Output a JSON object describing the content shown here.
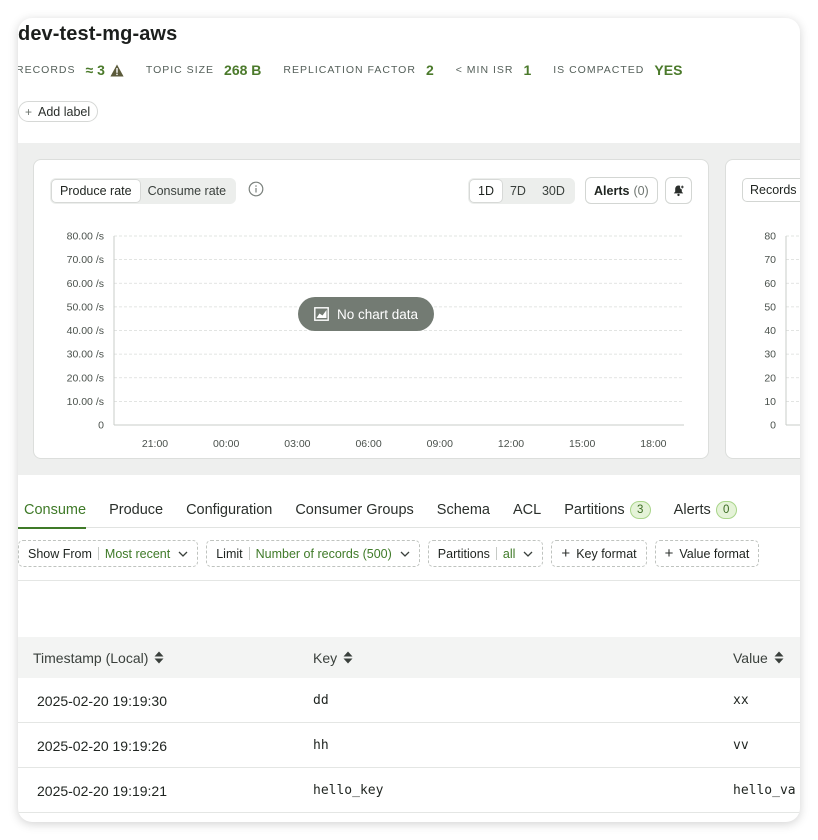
{
  "topic": {
    "title": "dev-test-mg-aws",
    "stats": {
      "records_label": "RECORDS",
      "records_value": "≈ 3",
      "topic_size_label": "TOPIC SIZE",
      "topic_size_value": "268 B",
      "replication_label": "REPLICATION FACTOR",
      "replication_value": "2",
      "min_isr_label": "< MIN ISR",
      "min_isr_value": "1",
      "compacted_label": "IS COMPACTED",
      "compacted_value": "YES"
    },
    "add_label": "Add label"
  },
  "chart_panel": {
    "rate_tabs": [
      "Produce rate",
      "Consume rate"
    ],
    "range_tabs": [
      "1D",
      "7D",
      "30D"
    ],
    "alerts_label": "Alerts",
    "alerts_count": "(0)",
    "no_data": "No chart data",
    "side_button": "Records"
  },
  "chart_data": [
    {
      "type": "line",
      "title": "",
      "xlabel": "",
      "ylabel": "",
      "x_ticks": [
        "21:00",
        "00:00",
        "03:00",
        "06:00",
        "09:00",
        "12:00",
        "15:00",
        "18:00"
      ],
      "y_ticks": [
        "0",
        "10.00 /s",
        "20.00 /s",
        "30.00 /s",
        "40.00 /s",
        "50.00 /s",
        "60.00 /s",
        "70.00 /s",
        "80.00 /s"
      ],
      "ylim": [
        0,
        80
      ],
      "grid": true,
      "series": []
    },
    {
      "type": "line",
      "title": "",
      "y_ticks": [
        "0",
        "10",
        "20",
        "30",
        "40",
        "50",
        "60",
        "70",
        "80"
      ],
      "ylim": [
        0,
        80
      ],
      "grid": true,
      "series": []
    }
  ],
  "tabs": [
    {
      "label": "Consume",
      "active": true
    },
    {
      "label": "Produce"
    },
    {
      "label": "Configuration"
    },
    {
      "label": "Consumer Groups"
    },
    {
      "label": "Schema"
    },
    {
      "label": "ACL"
    },
    {
      "label": "Partitions",
      "badge": "3"
    },
    {
      "label": "Alerts",
      "badge": "0"
    }
  ],
  "filters": {
    "show_from_label": "Show From",
    "show_from_value": "Most recent",
    "limit_label": "Limit",
    "limit_value": "Number of records (500)",
    "partitions_label": "Partitions",
    "partitions_value": "all",
    "key_format": "Key format",
    "value_format": "Value format"
  },
  "table": {
    "headers": [
      "Timestamp (Local)",
      "Key",
      "Value"
    ],
    "rows": [
      {
        "timestamp": "2025-02-20 19:19:30",
        "key": "dd",
        "value": "xx"
      },
      {
        "timestamp": "2025-02-20 19:19:26",
        "key": "hh",
        "value": "vv"
      },
      {
        "timestamp": "2025-02-20 19:19:21",
        "key": "hello_key",
        "value": "hello_va"
      }
    ]
  },
  "colors": {
    "accent": "#3f7a28",
    "stat_value": "#4b7a2b",
    "badge_bg": "#e5f3d8",
    "band": "#eeefee",
    "nodata_pill": "#737b73"
  }
}
